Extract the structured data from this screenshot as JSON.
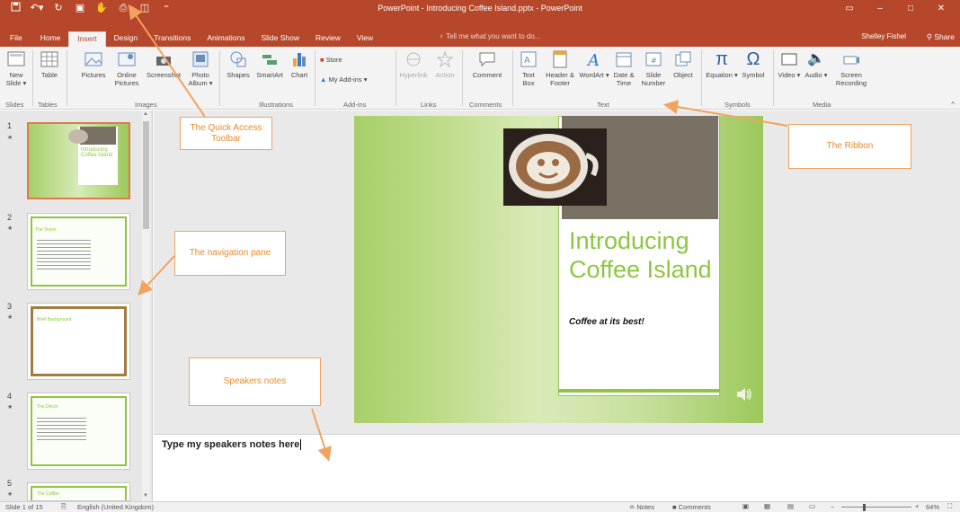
{
  "titlebar": {
    "title": "PowerPoint - Introducing Coffee Island.pptx - PowerPoint",
    "accent": "#b7472a",
    "qat_icons": [
      "save-icon",
      "undo-icon",
      "redo-icon",
      "present-icon",
      "touch-mode-icon"
    ]
  },
  "tabs": [
    "File",
    "Home",
    "Insert",
    "Design",
    "Transitions",
    "Animations",
    "Slide Show",
    "Review",
    "View"
  ],
  "active_tab": "Insert",
  "tellme": "Tell me what you want to do...",
  "user": "Shelley Fishel",
  "share": "Share",
  "ribbon": {
    "buttons": {
      "new_slide": "New Slide",
      "table": "Table",
      "pictures": "Pictures",
      "online_pictures": "Online Pictures",
      "screenshot": "Screenshot",
      "photo_album": "Photo Album",
      "shapes": "Shapes",
      "smartart": "SmartArt",
      "chart": "Chart",
      "store": "Store",
      "my_addins": "My Add-ins",
      "hyperlink": "Hyperlink",
      "action": "Action",
      "comment": "Comment",
      "text_box": "Text Box",
      "header_footer": "Header & Footer",
      "wordart": "WordArt",
      "date_time": "Date & Time",
      "slide_number": "Slide Number",
      "object": "Object",
      "equation": "Equation",
      "symbol": "Symbol",
      "video": "Video",
      "audio": "Audio",
      "screen_recording": "Screen Recording"
    },
    "groups": {
      "slides": "Slides",
      "tables": "Tables",
      "images": "Images",
      "illustrations": "Illustrations",
      "addins": "Add-ins",
      "links": "Links",
      "comments": "Comments",
      "text": "Text",
      "symbols": "Symbols",
      "media": "Media"
    }
  },
  "slides": [
    {
      "num": "1",
      "title": "Introducing Coffee Island"
    },
    {
      "num": "2",
      "title": "The Vision"
    },
    {
      "num": "3",
      "title": "Brief Background"
    },
    {
      "num": "4",
      "title": "The Décor"
    },
    {
      "num": "5",
      "title": "The Coffee"
    }
  ],
  "main_slide": {
    "title": "Introducing Coffee Island",
    "subtitle": "Coffee at its best!"
  },
  "notes": "Type my speakers notes here",
  "statusbar": {
    "slide_info": "Slide 1 of 15",
    "language": "English (United Kingdom)",
    "notes": "Notes",
    "comments": "Comments",
    "zoom": "64%"
  },
  "callouts": {
    "qat": "The Quick Access Toolbar",
    "ribbon": "The Ribbon",
    "navpane": "The navigation pane",
    "speaker_notes": "Speakers notes"
  },
  "colors": {
    "callout_text": "#e8892d",
    "slide_title": "#8dc63f"
  }
}
